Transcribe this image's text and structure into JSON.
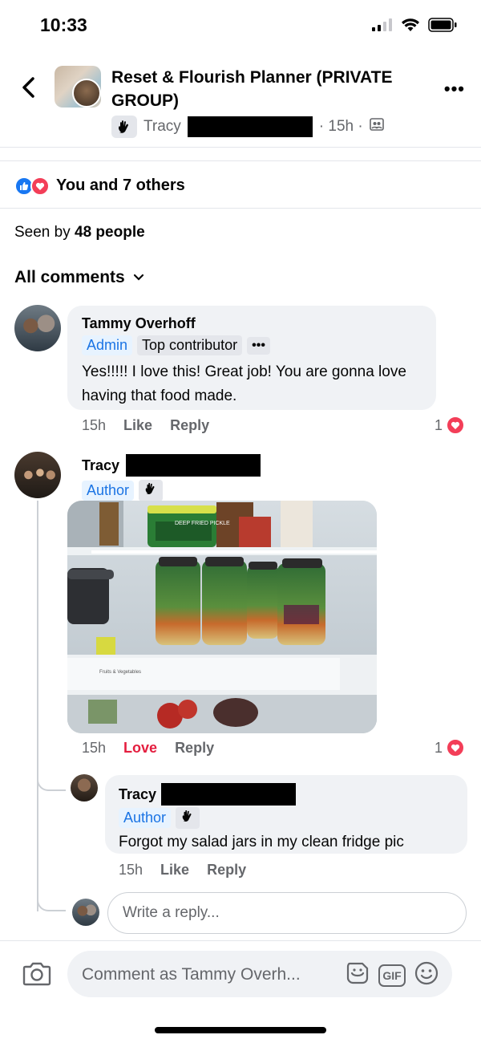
{
  "status_bar": {
    "time": "10:33"
  },
  "header": {
    "group_title": "Reset & Flourish Planner (PRIVATE GROUP)",
    "author": "Tracy",
    "time": "· 15h ·"
  },
  "reactions": {
    "text": "You and 7 others"
  },
  "seen_by": {
    "prefix": "Seen by",
    "count": "48 people"
  },
  "comments_filter": {
    "label": "All comments"
  },
  "comments": [
    {
      "name": "Tammy Overhoff",
      "badges": [
        "Admin",
        "Top contributor",
        "•••"
      ],
      "text": "Yes!!!!! I love this! Great job! You are gonna love having that food made.",
      "time": "15h",
      "like_label": "Like",
      "reply_label": "Reply",
      "reaction_count": "1"
    },
    {
      "name": "Tracy",
      "badges": [
        "Author"
      ],
      "image_label": "Fruits & Vegetables",
      "jar_label": "DEEP FRIED PICKLE",
      "time": "15h",
      "like_label": "Love",
      "reply_label": "Reply",
      "reaction_count": "1",
      "replies": [
        {
          "name": "Tracy",
          "badges": [
            "Author"
          ],
          "text": "Forgot my salad jars in my clean fridge pic",
          "time": "15h",
          "like_label": "Like",
          "reply_label": "Reply"
        }
      ]
    }
  ],
  "reply_input": {
    "placeholder": "Write a reply..."
  },
  "comment_bar": {
    "placeholder": "Comment as Tammy Overh...",
    "gif_label": "GIF"
  },
  "colors": {
    "accent": "#1877f2",
    "love": "#f33e58",
    "muted": "#65676b",
    "bubble": "#f0f2f5"
  }
}
